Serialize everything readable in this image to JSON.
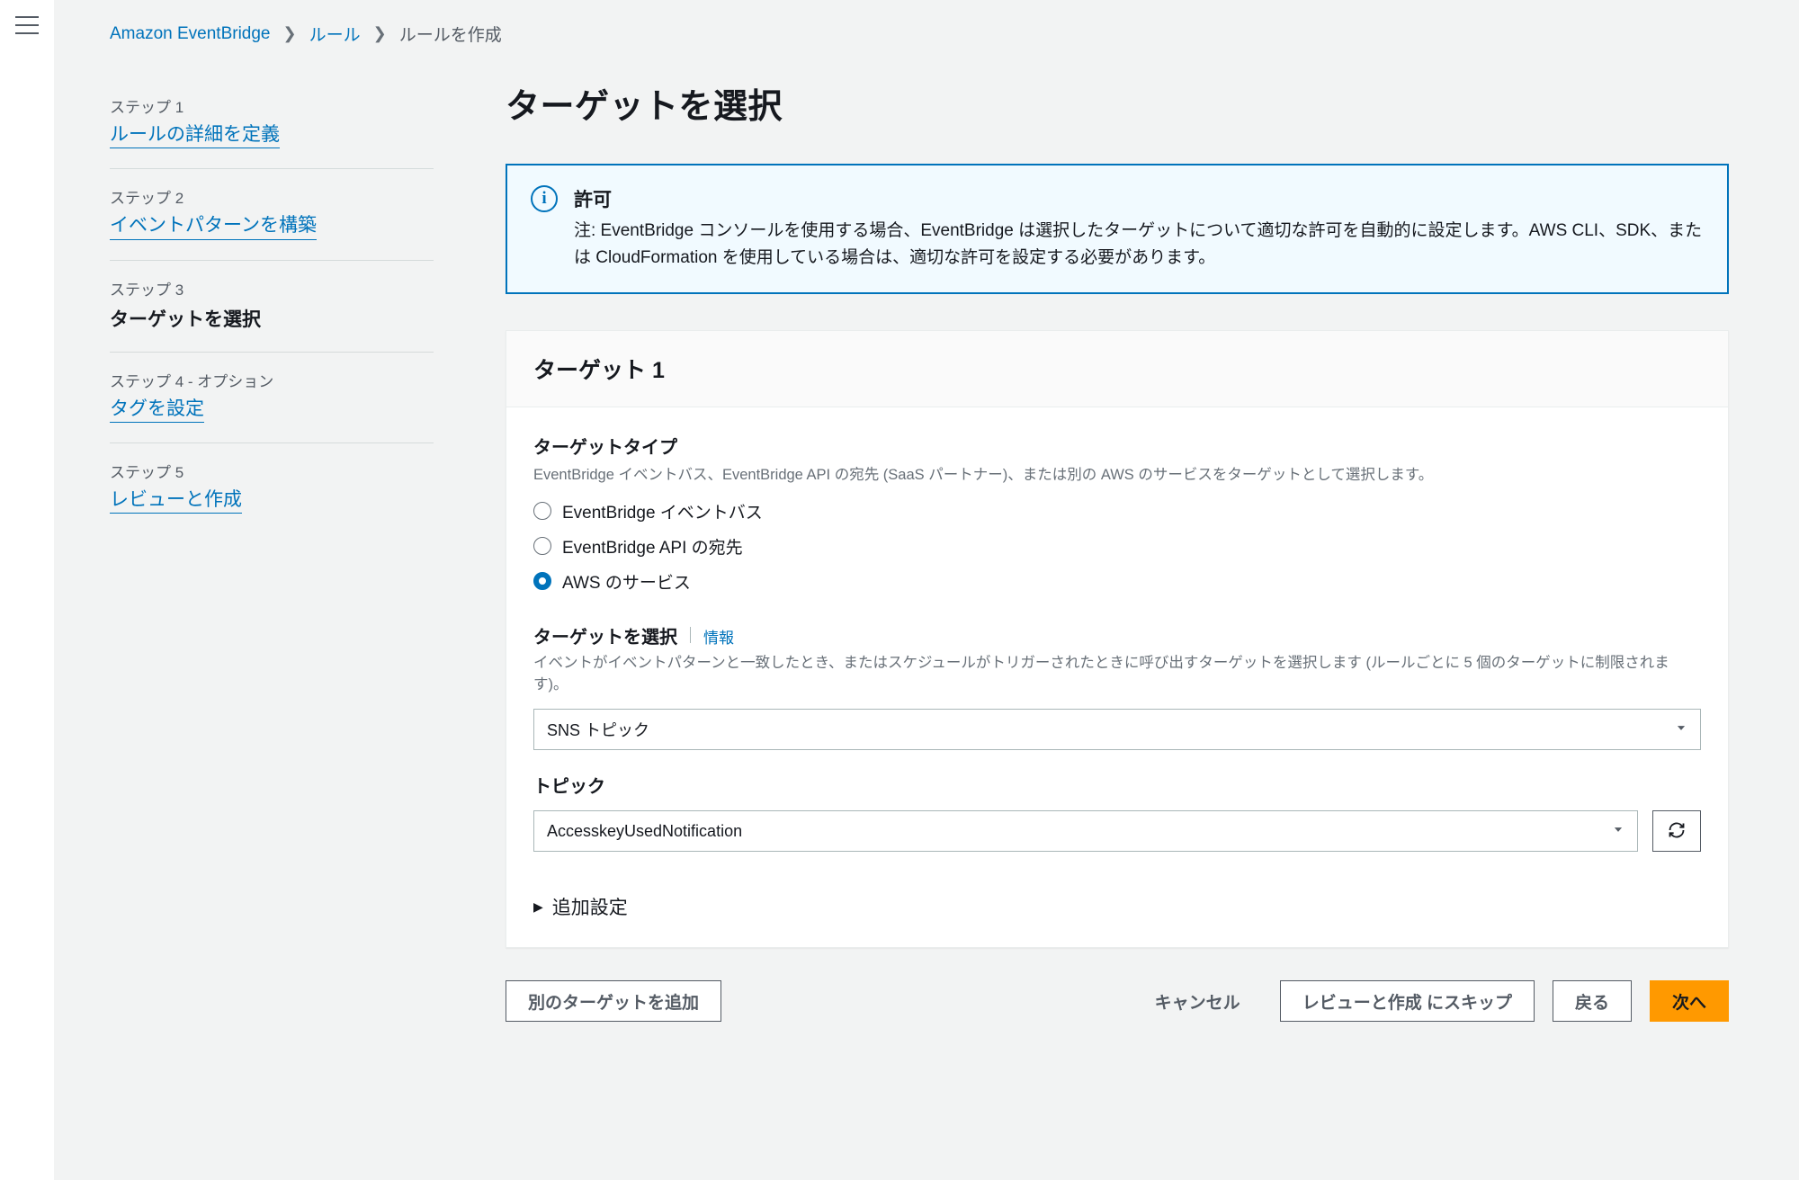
{
  "breadcrumbs": {
    "service": "Amazon EventBridge",
    "rules": "ルール",
    "create": "ルールを作成"
  },
  "steps": [
    {
      "label": "ステップ 1",
      "title": "ルールの詳細を定義",
      "link": true
    },
    {
      "label": "ステップ 2",
      "title": "イベントパターンを構築",
      "link": true
    },
    {
      "label": "ステップ 3",
      "title": "ターゲットを選択",
      "current": true
    },
    {
      "label": "ステップ 4 - オプション",
      "title": "タグを設定",
      "link": true
    },
    {
      "label": "ステップ 5",
      "title": "レビューと作成",
      "link": true
    }
  ],
  "page_title": "ターゲットを選択",
  "info_box": {
    "title": "許可",
    "body": "注: EventBridge コンソールを使用する場合、EventBridge は選択したターゲットについて適切な許可を自動的に設定します。AWS CLI、SDK、または CloudFormation を使用している場合は、適切な許可を設定する必要があります。"
  },
  "target_panel": {
    "heading": "ターゲット 1",
    "type_label": "ターゲットタイプ",
    "type_help": "EventBridge イベントバス、EventBridge API の宛先 (SaaS パートナー)、または別の AWS のサービスをターゲットとして選択します。",
    "radio_options": [
      "EventBridge イベントバス",
      "EventBridge API の宛先",
      "AWS のサービス"
    ],
    "radio_selected_index": 2,
    "select_target_label": "ターゲットを選択",
    "info_link": "情報",
    "select_target_help": "イベントがイベントパターンと一致したとき、またはスケジュールがトリガーされたときに呼び出すターゲットを選択します (ルールごとに 5 個のターゲットに制限されます)。",
    "target_service_value": "SNS トピック",
    "topic_label": "トピック",
    "topic_value": "AccesskeyUsedNotification",
    "additional_settings": "追加設定"
  },
  "footer": {
    "add_another": "別のターゲットを追加",
    "cancel": "キャンセル",
    "skip_review": "レビューと作成 にスキップ",
    "back": "戻る",
    "next": "次へ"
  }
}
